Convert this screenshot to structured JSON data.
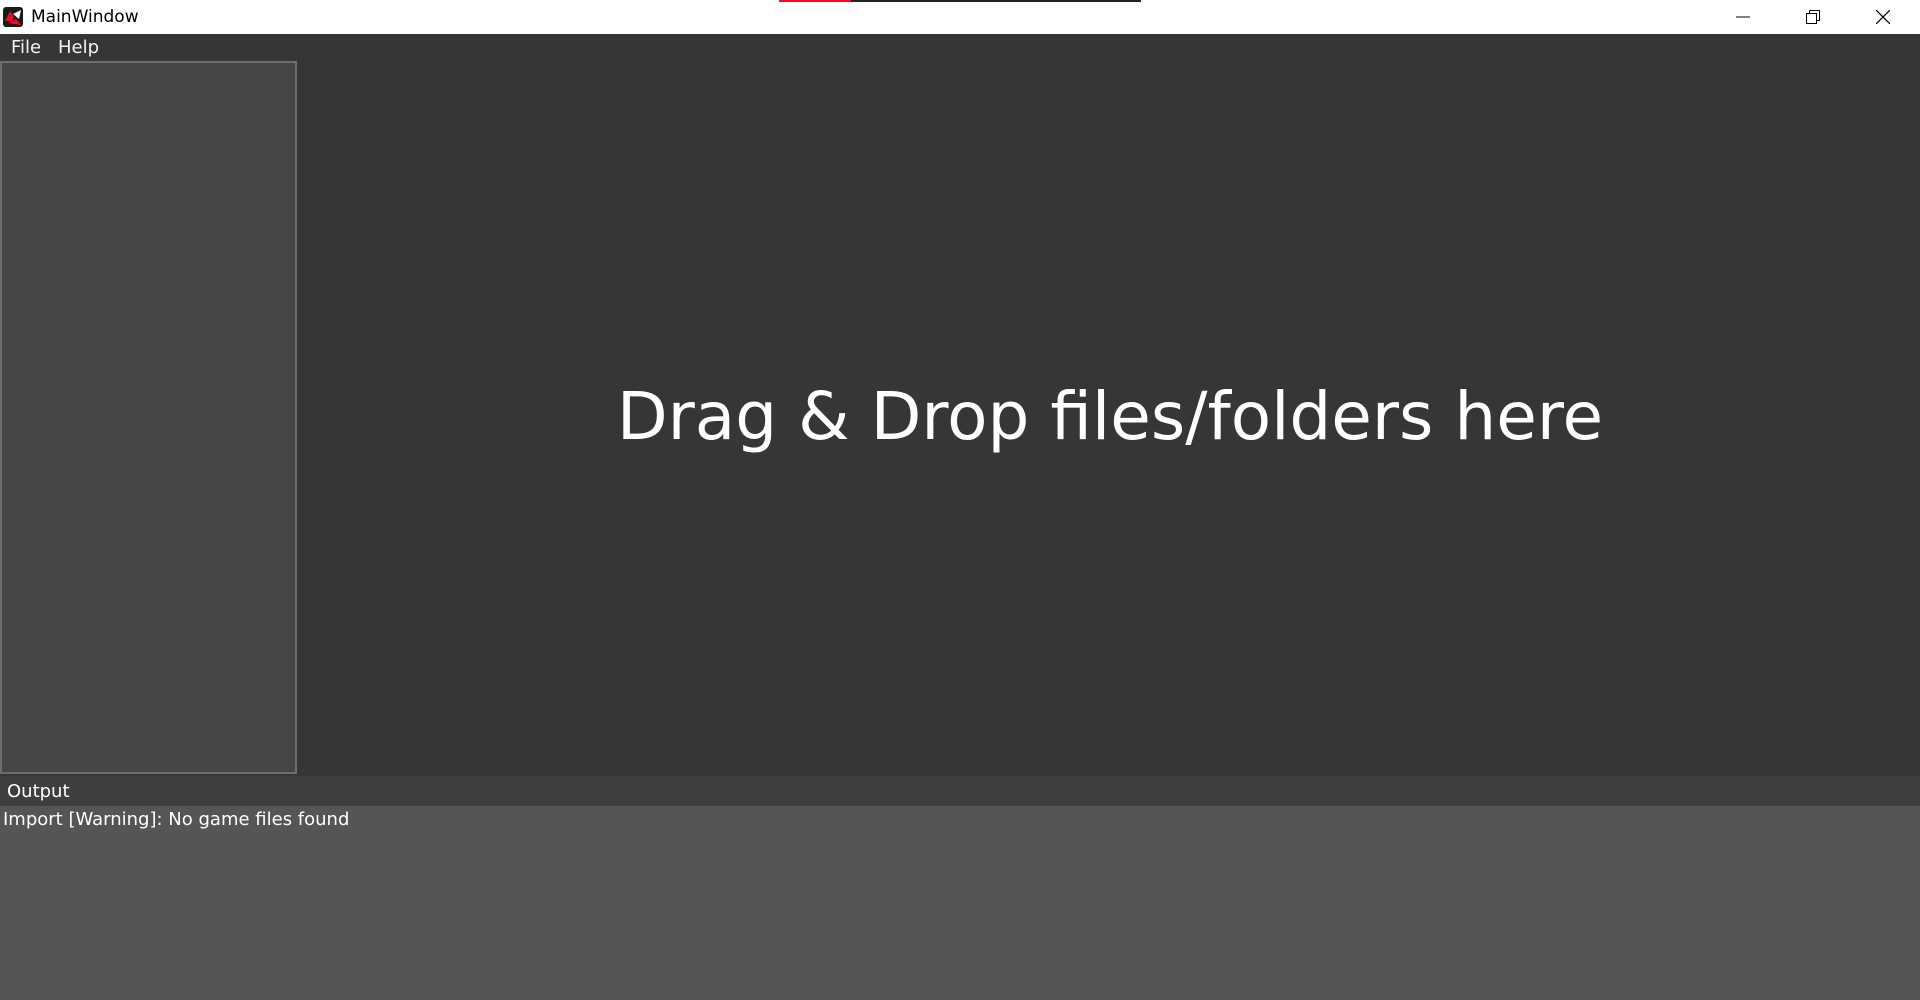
{
  "window": {
    "title": "MainWindow",
    "icon": "app-logo-icon",
    "controls": {
      "minimize_icon": "minimize-icon",
      "maximize_icon": "restore-icon",
      "close_icon": "close-icon"
    },
    "progress_fraction": 0.2
  },
  "menu": {
    "items": [
      {
        "label": "File"
      },
      {
        "label": "Help"
      }
    ]
  },
  "main": {
    "drop_hint": "Drag & Drop files/folders here"
  },
  "output": {
    "title": "Output",
    "lines": [
      "Import [Warning]: No game files found"
    ]
  },
  "colors": {
    "background": "#363636",
    "side_panel": "#464646",
    "output_body": "#555555",
    "progress_accent": "#e81123"
  }
}
